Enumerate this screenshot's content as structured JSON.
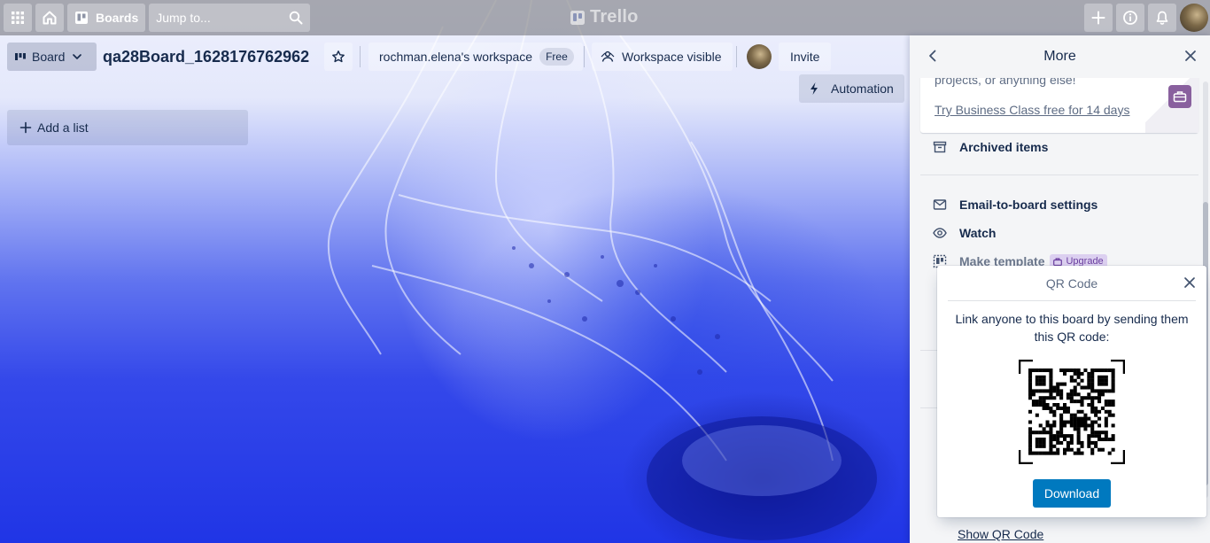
{
  "header": {
    "apps_icon": "grid-icon",
    "home_icon": "home-icon",
    "boards_label": "Boards",
    "search_placeholder": "Jump to...",
    "logo_text": "Trello",
    "right_icons": [
      "plus-icon",
      "info-icon",
      "bell-icon"
    ]
  },
  "board": {
    "view_label": "Board",
    "title": "qa28Board_1628176762962",
    "workspace_name": "rochman.elena's workspace",
    "workspace_badge": "Free",
    "visibility_label": "Workspace visible",
    "invite_label": "Invite",
    "automation_label": "Automation",
    "add_list_label": "Add a list"
  },
  "sidebar": {
    "title": "More",
    "promo_text": "projects, or anything else!",
    "promo_link": "Try Business Class free for 14 days",
    "items": [
      {
        "label": "Archived items",
        "icon": "archive-icon"
      },
      {
        "label": "Email-to-board settings",
        "icon": "mail-icon"
      },
      {
        "label": "Watch",
        "icon": "eye-icon"
      },
      {
        "label": "Make template",
        "icon": "template-icon",
        "badge": "Upgrade"
      }
    ],
    "show_qr_label": "Show QR Code"
  },
  "qr_popover": {
    "title": "QR Code",
    "description": "Link anyone to this board by sending them this QR code:",
    "download_label": "Download"
  },
  "colors": {
    "accent": "#0079bf",
    "upgrade_bg": "#dcd0f0",
    "upgrade_text": "#6b3fa0"
  }
}
